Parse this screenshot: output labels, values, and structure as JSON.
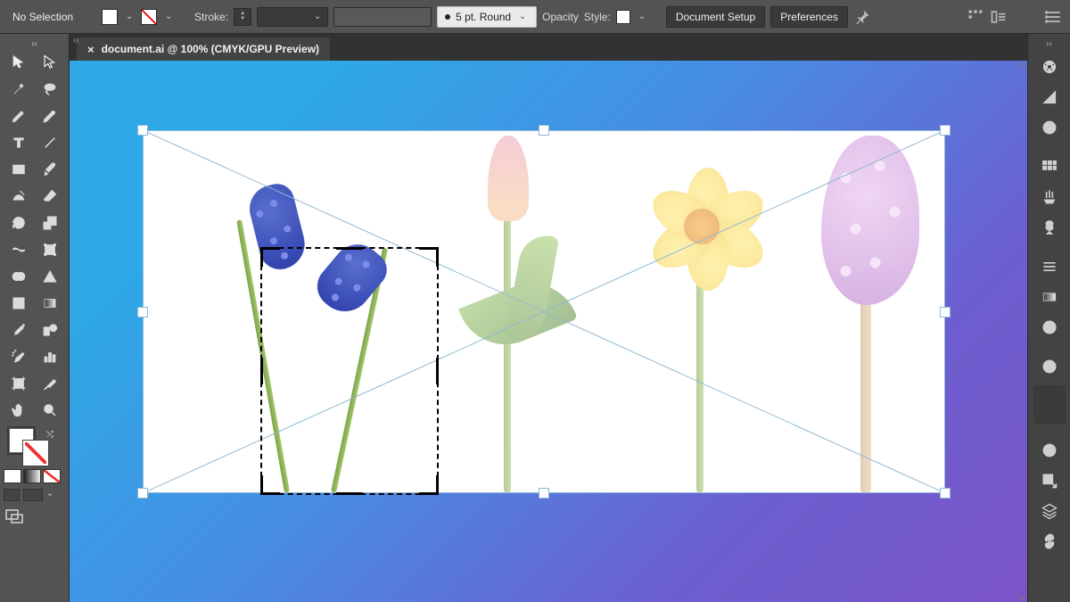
{
  "topbar": {
    "selection_label": "No Selection",
    "stroke_label": "Stroke:",
    "brush_label": "5 pt. Round",
    "opacity_label": "Opacity",
    "style_label": "Style:",
    "document_setup_btn": "Document Setup",
    "preferences_btn": "Preferences",
    "fill_color": "#ffffff",
    "stroke_value": ""
  },
  "tab": {
    "title": "document.ai @ 100% (CMYK/GPU Preview)"
  },
  "tools": {
    "left": [
      "selection-tool",
      "direct-selection-tool",
      "magic-wand-tool",
      "lasso-tool",
      "pen-tool",
      "curvature-tool",
      "type-tool",
      "line-segment-tool",
      "rectangle-tool",
      "paintbrush-tool",
      "shaper-tool",
      "eraser-tool",
      "rotate-tool",
      "scale-tool",
      "width-tool",
      "free-transform-tool",
      "shape-builder-tool",
      "perspective-grid-tool",
      "mesh-tool",
      "gradient-tool",
      "eyedropper-tool",
      "blend-tool",
      "symbol-sprayer-tool",
      "column-graph-tool",
      "artboard-tool",
      "slice-tool",
      "hand-tool",
      "zoom-tool"
    ]
  },
  "right_panels": [
    "properties-panel",
    "color-panel",
    "shape-panel",
    "navigator-panel",
    "swatches-panel",
    "brushes-panel",
    "symbols-panel",
    "stroke-panel",
    "gradient-panel",
    "transparency-panel",
    "appearance-panel",
    "cc-libraries-panel",
    "export-panel",
    "layers-panel",
    "links-panel"
  ],
  "canvas": {
    "image_description": "Four spring flowers on white background: blue muscari, pink tulip, yellow daffodil, purple hyacinth",
    "crop_marquee_on": "muscari"
  }
}
